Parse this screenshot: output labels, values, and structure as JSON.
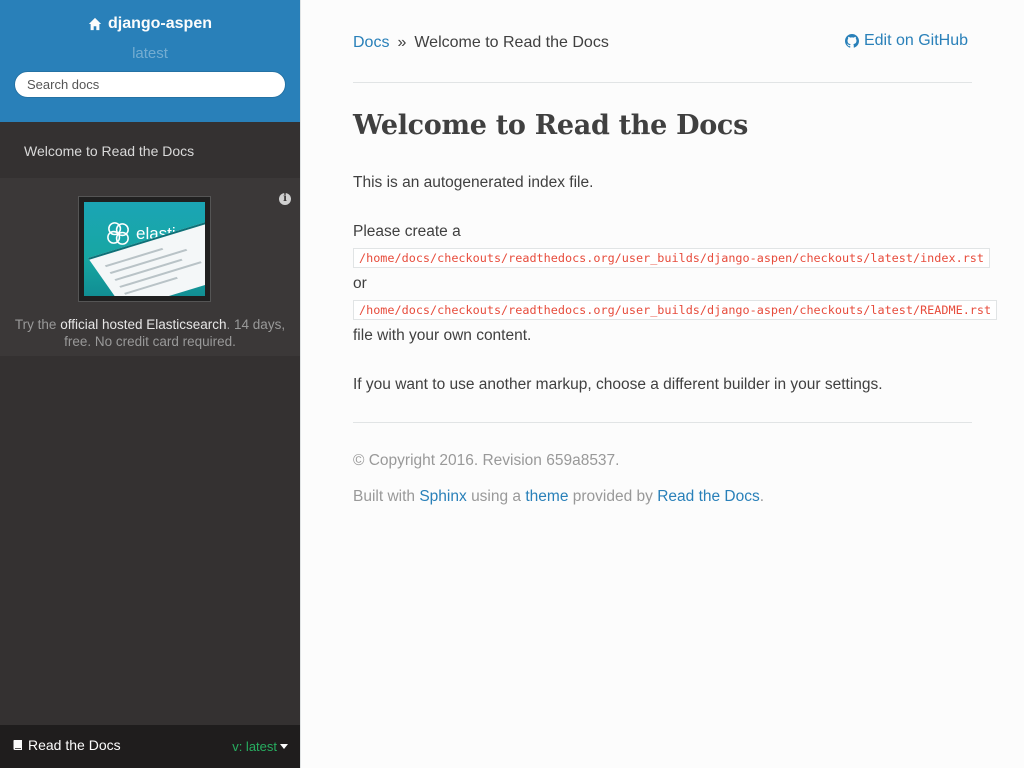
{
  "sidebar": {
    "project_name": "django-aspen",
    "version": "latest",
    "search_placeholder": "Search docs",
    "nav_items": [
      {
        "label": "Welcome to Read the Docs"
      }
    ],
    "ad": {
      "info_icon": "i",
      "brand": "elastic",
      "text_prefix": "Try the ",
      "link_text": "official hosted Elasticsearch",
      "text_suffix": ". 14 days, free. No credit card required."
    },
    "footer": {
      "label": "Read the Docs",
      "version_label": "v: latest"
    }
  },
  "main": {
    "breadcrumb": {
      "root": "Docs",
      "separator": "»",
      "current": "Welcome to Read the Docs"
    },
    "edit_link": "Edit on GitHub",
    "title": "Welcome to Read the Docs",
    "p1": "This is an autogenerated index file.",
    "p2": "Please create a",
    "code1": "/home/docs/checkouts/readthedocs.org/user_builds/django-aspen/checkouts/latest/index.rst",
    "or": "or",
    "code2": "/home/docs/checkouts/readthedocs.org/user_builds/django-aspen/checkouts/latest/README.rst",
    "p3": "file with your own content.",
    "p4": "If you want to use another markup, choose a different builder in your settings.",
    "copyright": "© Copyright 2016. Revision 659a8537.",
    "built_prefix": "Built with",
    "sphinx": "Sphinx",
    "using": "using a",
    "theme": "theme",
    "provided": "provided by",
    "rtd": "Read the Docs",
    "period": "."
  },
  "colors": {
    "sidebar_header": "#2980b9",
    "sidebar": "#343131",
    "link": "#2980b9",
    "code": "#e74c3c",
    "version": "#27ae60"
  }
}
